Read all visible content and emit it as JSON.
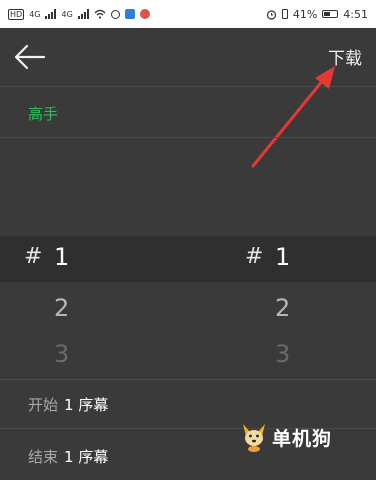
{
  "status_bar": {
    "battery_percent": "41%",
    "time": "4:51",
    "hd_badge": "HD",
    "network_labels": [
      "4G",
      "4G"
    ]
  },
  "toolbar": {
    "download_label": "下载"
  },
  "title": "高手",
  "picker": {
    "hash": "#",
    "left_values": [
      "1",
      "2",
      "3"
    ],
    "right_values": [
      "1",
      "2",
      "3"
    ],
    "selected_left": "1",
    "selected_right": "1"
  },
  "rows": {
    "start_label": "开始",
    "start_value": "1 序幕",
    "end_label": "结束",
    "end_value": "1 序幕"
  },
  "watermark": "单机狗",
  "colors": {
    "background": "#3a3a3a",
    "title_green": "#2fbf5a",
    "annotation_arrow": "#e53935"
  }
}
